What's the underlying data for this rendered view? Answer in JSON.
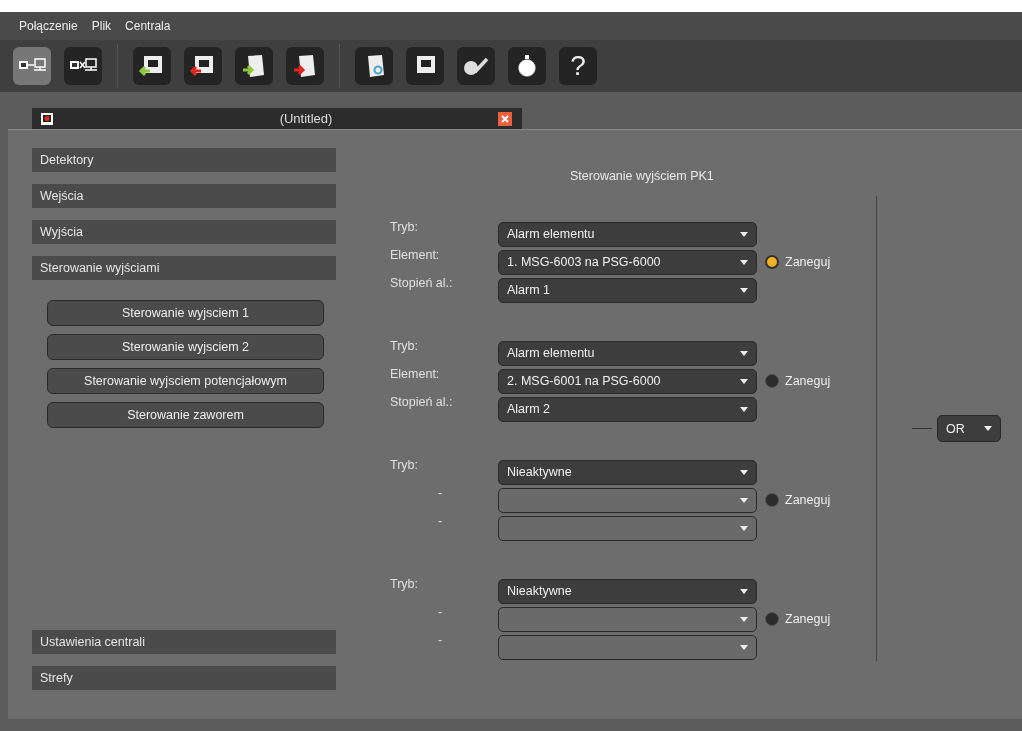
{
  "menu": [
    "Połączenie",
    "Plik",
    "Centrala"
  ],
  "toolbar": [
    {
      "kind": "connect",
      "selected": true
    },
    {
      "kind": "disconnect",
      "selected": false
    },
    {
      "kind": "screen-in",
      "selected": false
    },
    {
      "kind": "screen-out",
      "selected": false
    },
    {
      "kind": "file-in",
      "selected": false
    },
    {
      "kind": "file-out",
      "selected": false
    },
    {
      "kind": "file-gear",
      "selected": false
    },
    {
      "kind": "screen",
      "selected": false
    },
    {
      "kind": "ball-pen",
      "selected": false
    },
    {
      "kind": "stopwatch",
      "selected": false
    },
    {
      "kind": "help",
      "label": "?",
      "selected": false
    }
  ],
  "document_tab": {
    "title": "(Untitled)"
  },
  "sidebar": {
    "top_items": [
      "Detektory",
      "Wejścia",
      "Wyjścia",
      "Sterowanie wyjściami"
    ],
    "sub_buttons": [
      "Sterowanie wyjsciem 1",
      "Sterowanie wyjsciem 2",
      "Sterowanie wyjsciem potencjałowym",
      "Sterowanie zaworem"
    ],
    "bottom_items": [
      "Ustawienia centrali",
      "Strefy"
    ]
  },
  "form": {
    "title": "Sterowanie wyjściem PK1",
    "groups": [
      {
        "negate": {
          "label": "Zaneguj",
          "checked": true
        },
        "rows": [
          {
            "label": "Tryb:",
            "value": "Alarm elementu",
            "disabled": false
          },
          {
            "label": "Element:",
            "value": "1. MSG-6003 na PSG-6000",
            "disabled": false
          },
          {
            "label": "Stopień al.:",
            "value": "Alarm 1",
            "disabled": false
          }
        ]
      },
      {
        "negate": {
          "label": "Zaneguj",
          "checked": false
        },
        "rows": [
          {
            "label": "Tryb:",
            "value": "Alarm elementu",
            "disabled": false
          },
          {
            "label": "Element:",
            "value": "2. MSG-6001 na PSG-6000",
            "disabled": false
          },
          {
            "label": "Stopień al.:",
            "value": "Alarm 2",
            "disabled": false
          }
        ]
      },
      {
        "negate": {
          "label": "Zaneguj",
          "checked": false
        },
        "rows": [
          {
            "label": "Tryb:",
            "value": "Nieaktywne",
            "disabled": false
          },
          {
            "label": "-",
            "disabled": true
          },
          {
            "label": "-",
            "disabled": true
          }
        ]
      },
      {
        "negate": {
          "label": "Zaneguj",
          "checked": false
        },
        "rows": [
          {
            "label": "Tryb:",
            "value": "Nieaktywne",
            "disabled": false
          },
          {
            "label": "-",
            "disabled": true
          },
          {
            "label": "-",
            "disabled": true
          }
        ]
      }
    ],
    "logic": {
      "value": "OR"
    }
  }
}
